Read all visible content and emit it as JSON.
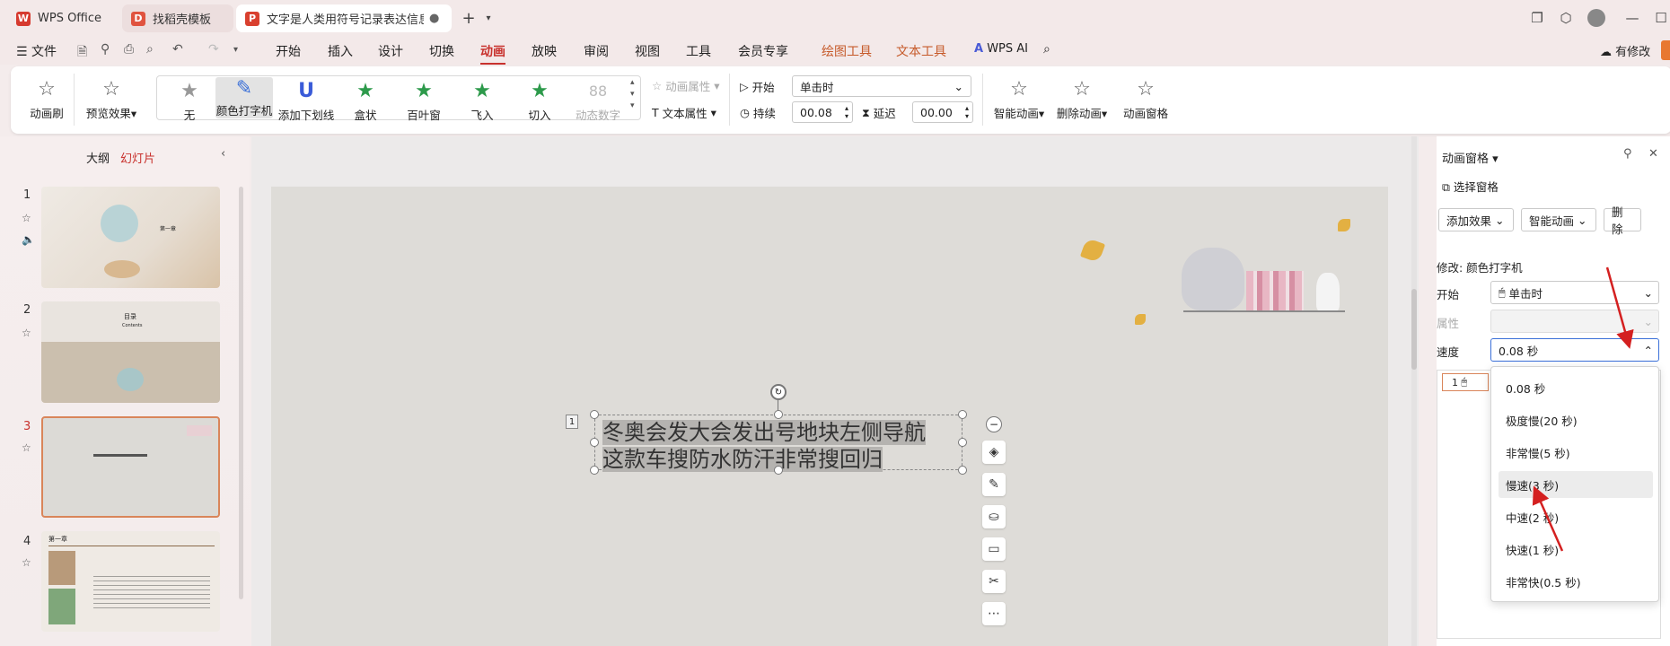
{
  "tabs": [
    {
      "label": "WPS Office",
      "icon": "wps-logo-icon"
    },
    {
      "label": "找稻壳模板",
      "icon": "docer-icon"
    },
    {
      "label": "文字是人类用符号记录表达信息以(",
      "icon": "ppt-file-icon"
    }
  ],
  "menu": {
    "file": "文件",
    "items": [
      "开始",
      "插入",
      "设计",
      "切换",
      "动画",
      "放映",
      "审阅",
      "视图",
      "工具",
      "会员专享"
    ],
    "active": "动画",
    "context_tools": [
      "绘图工具",
      "文本工具"
    ],
    "wps_ai": "WPS AI",
    "modify": "有修改"
  },
  "ribbon": {
    "anim_brush": "动画刷",
    "preview": "预览效果",
    "effects": [
      "无",
      "颜色打字机",
      "添加下划线",
      "盒状",
      "百叶窗",
      "飞入",
      "切入",
      "动态数字"
    ],
    "anim_props": "动画属性",
    "text_props": "文本属性",
    "start_label": "开始",
    "start_value": "单击时",
    "duration_label": "持续",
    "duration_value": "00.08",
    "delay_label": "延迟",
    "delay_value": "00.00",
    "smart_anim": "智能动画",
    "delete_anim": "删除动画",
    "anim_pane": "动画窗格"
  },
  "left": {
    "outline": "大纲",
    "slides": "幻灯片",
    "numbers": [
      "1",
      "2",
      "3",
      "4"
    ],
    "slide1_title": "第一章",
    "slide2_title": "目录",
    "slide2_sub": "Contents",
    "slide4_title": "第一章"
  },
  "slide": {
    "marker": "1",
    "text": "冬奥会发大会发出号地块左侧导航这款车搜防水防汗非常搜回归"
  },
  "panel": {
    "title": "动画窗格",
    "select_pane": "选择窗格",
    "add_effect": "添加效果",
    "smart_anim": "智能动画",
    "delete": "删除",
    "modify_label": "修改: 颜色打字机",
    "start_label": "开始",
    "start_value": "单击时",
    "property_label": "属性",
    "speed_label": "速度",
    "speed_value": "0.08 秒",
    "list_item": "1"
  },
  "dropdown": {
    "options": [
      "0.08 秒",
      "极度慢(20 秒)",
      "非常慢(5 秒)",
      "慢速(3 秒)",
      "中速(2 秒)",
      "快速(1 秒)",
      "非常快(0.5 秒)"
    ],
    "highlighted": "慢速(3 秒)"
  },
  "colors": {
    "accent": "#c8312d",
    "context": "#c65a2a",
    "annotation_arrow": "#d42020"
  }
}
